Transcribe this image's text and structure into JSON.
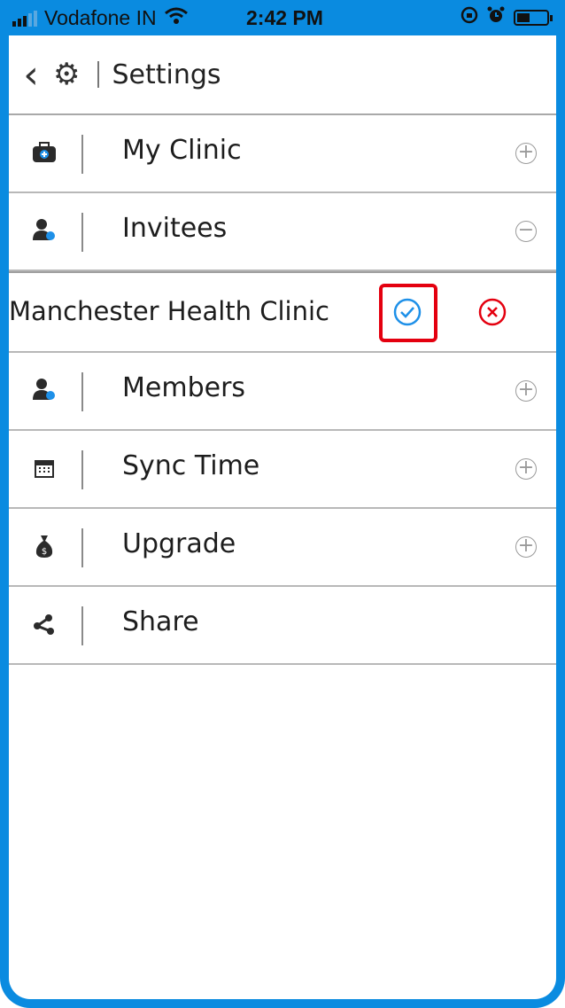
{
  "status": {
    "carrier": "Vodafone IN",
    "time": "2:42 PM"
  },
  "header": {
    "title": "Settings"
  },
  "menu": [
    {
      "label": "My Clinic",
      "icon": "clinic-bag-icon",
      "state": "+"
    },
    {
      "label": "Invitees",
      "icon": "user-plus-icon",
      "state": "−"
    },
    {
      "label": "Members",
      "icon": "user-plus-icon",
      "state": "+"
    },
    {
      "label": "Sync Time",
      "icon": "calendar-icon",
      "state": "+"
    },
    {
      "label": "Upgrade",
      "icon": "money-bag-icon",
      "state": "+"
    },
    {
      "label": "Share",
      "icon": "share-icon",
      "state": ""
    }
  ],
  "invite": {
    "name": "Manchester Health Clinic"
  },
  "colors": {
    "accent": "#0a8be0",
    "accept": "#1e90e8",
    "reject": "#e4000f",
    "highlight": "#e4000f"
  }
}
